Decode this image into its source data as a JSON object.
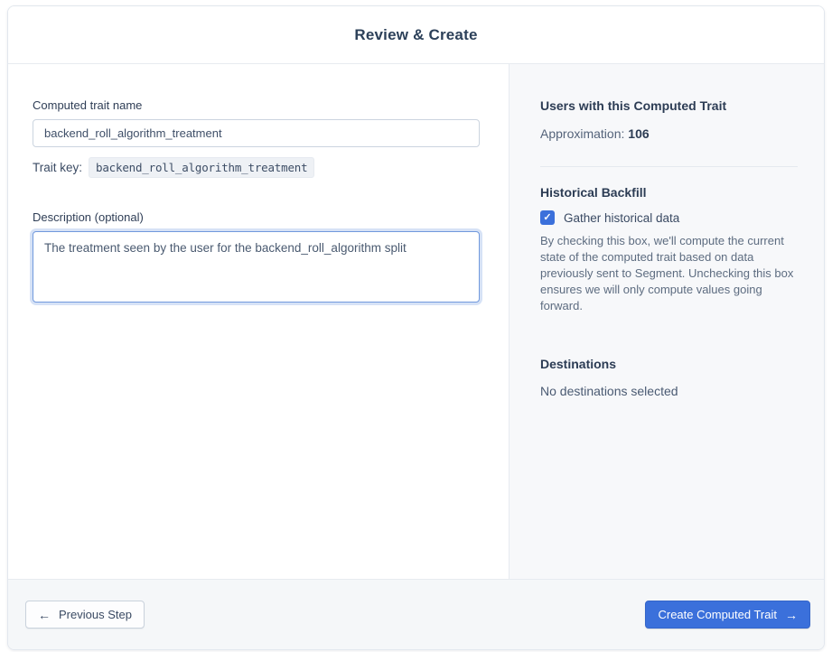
{
  "header": {
    "title": "Review & Create"
  },
  "form": {
    "name_label": "Computed trait name",
    "name_value": "backend_roll_algorithm_treatment",
    "trait_key_label": "Trait key:",
    "trait_key_value": "backend_roll_algorithm_treatment",
    "description_label": "Description (optional)",
    "description_value": "The treatment seen by the user for the backend_roll_algorithm split"
  },
  "summary": {
    "users_heading": "Users with this Computed Trait",
    "approximation_label": "Approximation:",
    "approximation_value": "106",
    "backfill_heading": "Historical Backfill",
    "backfill_checkbox_label": "Gather historical data",
    "backfill_checked": true,
    "backfill_description": "By checking this box, we'll compute the current state of the computed trait based on data previously sent to Segment. Unchecking this box ensures we will only compute values going forward.",
    "destinations_heading": "Destinations",
    "destinations_value": "No destinations selected"
  },
  "footer": {
    "previous_label": "Previous Step",
    "create_label": "Create Computed Trait"
  },
  "icons": {
    "back_arrow": "←",
    "forward_arrow": "→",
    "checkmark": "✓"
  },
  "colors": {
    "accent_blue": "#3B70DB",
    "panel_background": "#F7F8FA",
    "footer_background": "#F5F7F9",
    "heading_text": "#2C3C54",
    "body_text": "#5D6C80",
    "border": "#E7EBF0",
    "focused_field_border": "#7199DD"
  }
}
